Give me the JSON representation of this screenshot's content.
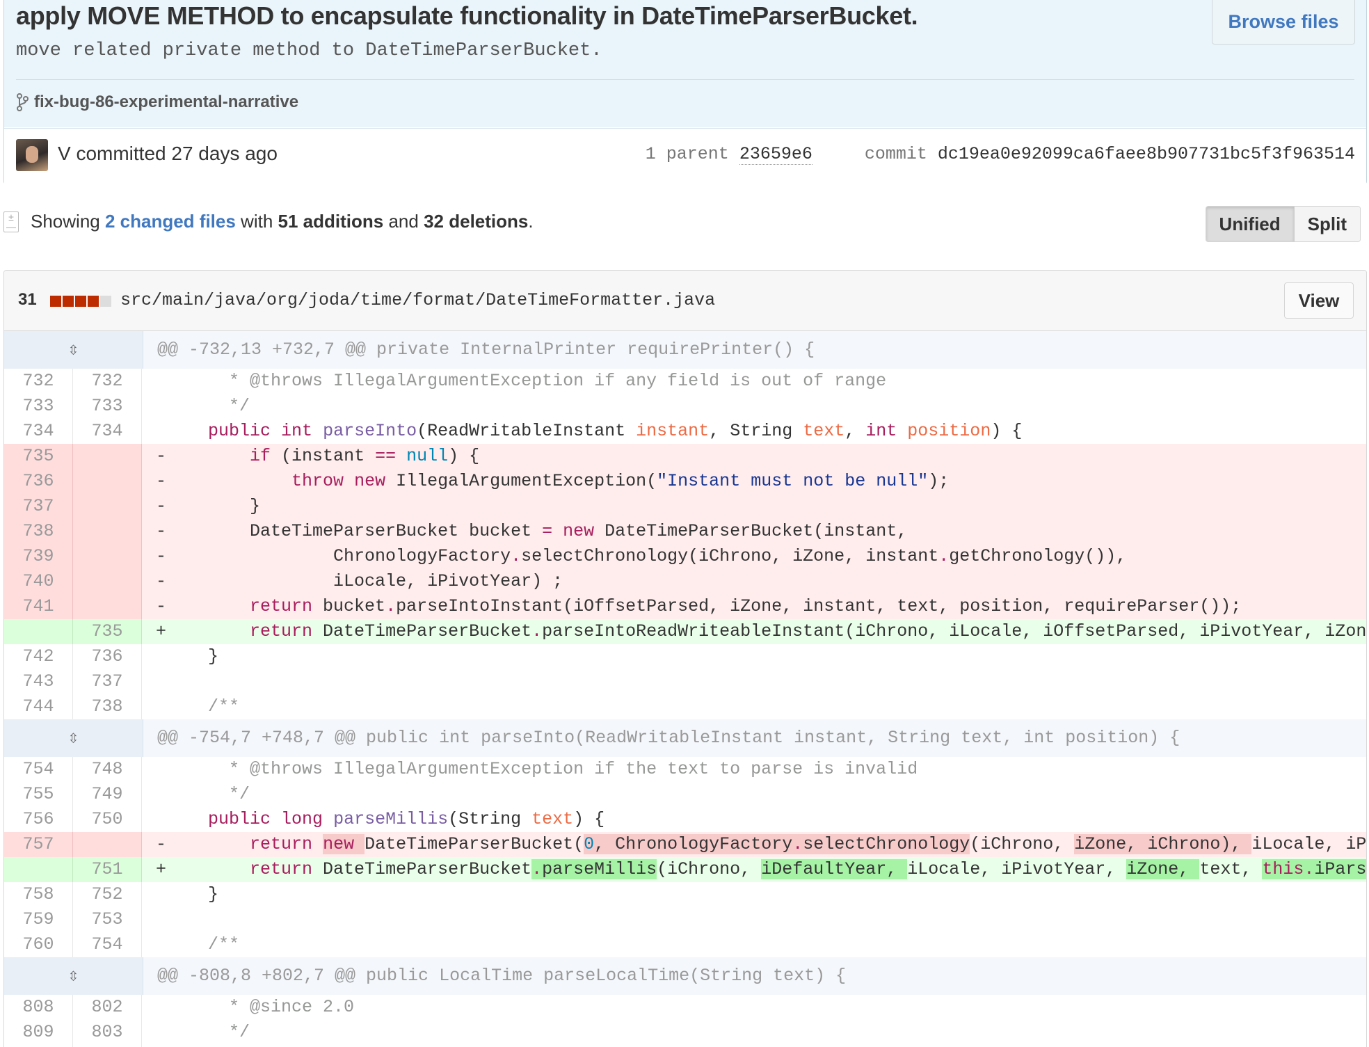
{
  "commit": {
    "title": "apply MOVE METHOD to encapsulate functionality in DateTimeParserBucket.",
    "description": "move related private method to DateTimeParserBucket.",
    "browse_files_label": "Browse files",
    "branch": "fix-bug-86-experimental-narrative",
    "committer_text": "V committed 27 days ago",
    "parent_label": "1 parent",
    "parent_sha": "23659e6",
    "commit_label": "commit",
    "commit_sha": "dc19ea0e92099ca6faee8b907731bc5f3f963514"
  },
  "summary": {
    "showing": "Showing",
    "changed_files": "2 changed files",
    "with": "with",
    "additions": "51 additions",
    "and": "and",
    "deletions": "32 deletions",
    "end": ".",
    "unified_label": "Unified",
    "split_label": "Split"
  },
  "file": {
    "change_count": "31",
    "path": "src/main/java/org/joda/time/format/DateTimeFormatter.java",
    "view_label": "View",
    "diffstat_colors": {
      "deletion": "#bd2c00",
      "neutral": "#dddddd"
    }
  },
  "icons": {
    "expand": "expand-icon",
    "branch": "branch-icon",
    "file_diff": "file-diff-icon"
  },
  "colors": {
    "link": "#4078c0",
    "deleted_row": "#ffecec",
    "added_row": "#eaffea",
    "hunk_header": "#f4f7fb"
  }
}
